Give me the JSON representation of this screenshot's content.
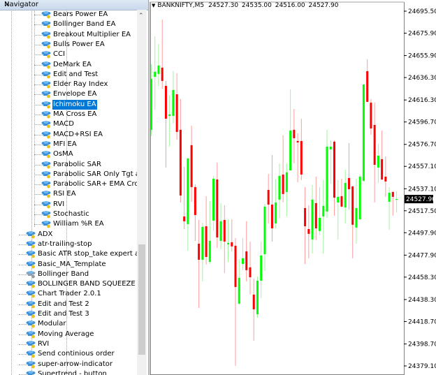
{
  "navigator": {
    "title": "Navigator",
    "close_label": "×",
    "items": [
      {
        "label": "Bears Power EA",
        "level": 2
      },
      {
        "label": "Bollinger Band EA",
        "level": 2
      },
      {
        "label": "Breakout Multiplier EA",
        "level": 2
      },
      {
        "label": "Bulls Power EA",
        "level": 2
      },
      {
        "label": "CCI",
        "level": 2
      },
      {
        "label": "DeMark EA",
        "level": 2
      },
      {
        "label": "Edit and Test",
        "level": 2
      },
      {
        "label": "Elder Ray Index",
        "level": 2
      },
      {
        "label": "Envelope EA",
        "level": 2
      },
      {
        "label": "Ichimoku EA",
        "level": 2,
        "selected": true
      },
      {
        "label": "MA Cross EA",
        "level": 2
      },
      {
        "label": "MACD",
        "level": 2
      },
      {
        "label": "MACD+RSI EA",
        "level": 2
      },
      {
        "label": "MFI EA",
        "level": 2
      },
      {
        "label": "OsMA",
        "level": 2
      },
      {
        "label": "Parabolic SAR",
        "level": 2
      },
      {
        "label": "Parabolic SAR Only Tgt and",
        "level": 2
      },
      {
        "label": "Parabolic SAR+ EMA Cross",
        "level": 2
      },
      {
        "label": "RSI EA",
        "level": 2
      },
      {
        "label": "RVI",
        "level": 2
      },
      {
        "label": "Stochastic",
        "level": 2
      },
      {
        "label": "William %R EA",
        "level": 2
      },
      {
        "label": "ADX",
        "level": 1
      },
      {
        "label": "atr-trailing-stop",
        "level": 1
      },
      {
        "label": "Basic ATR stop_take expert advi",
        "level": 1
      },
      {
        "label": "Basic_MA_Template",
        "level": 1
      },
      {
        "label": "Bollinger Band",
        "level": 1,
        "grey": true
      },
      {
        "label": "BOLLINGER BAND SQUEEZE",
        "level": 1
      },
      {
        "label": "Chart Trader 2.0.1",
        "level": 1
      },
      {
        "label": "Edit and Test 2",
        "level": 1
      },
      {
        "label": "Edit and Test 3",
        "level": 1
      },
      {
        "label": "Modular",
        "level": 1
      },
      {
        "label": "Moving Average",
        "level": 1
      },
      {
        "label": "RVI",
        "level": 1
      },
      {
        "label": "Send continious order",
        "level": 1
      },
      {
        "label": "super-arrow-indicator",
        "level": 1
      },
      {
        "label": "Supertrend - button",
        "level": 1
      }
    ]
  },
  "chart": {
    "symbol": "BANKNIFTY,M5",
    "ohlc_readout": "24527.30 24535.00 24516.00 24527.90",
    "current_price": "24527.90",
    "colors": {
      "bull": "#00ff00",
      "bear": "#ff0000",
      "bull_wick": "#9ef59e",
      "bear_wick": "#ff9c9c",
      "current_bg": "#000000"
    }
  },
  "chart_data": {
    "type": "candlestick",
    "ylim": [
      24379.1,
      24695.5
    ],
    "y_ticks": [
      "24695.50",
      "24675.90",
      "24655.90",
      "24636.30",
      "24616.30",
      "24596.70",
      "24576.70",
      "24557.10",
      "24537.10",
      "24517.50",
      "24497.90",
      "24477.90",
      "24458.30",
      "24438.30",
      "24418.70",
      "24398.70",
      "24379.10"
    ],
    "candles": [
      [
        24589.7,
        24648.2,
        24584.1,
        24635.1
      ],
      [
        24637.0,
        24673.1,
        24607.7,
        24641.4
      ],
      [
        24639.5,
        24666.3,
        24628.9,
        24647.0
      ],
      [
        24645.1,
        24688.1,
        24626.4,
        24633.3
      ],
      [
        24628.9,
        24633.3,
        24556.0,
        24599.6
      ],
      [
        24602.1,
        24620.2,
        24574.7,
        24603.4
      ],
      [
        24602.1,
        24642.0,
        24595.3,
        24625.2
      ],
      [
        24621.4,
        24640.1,
        24580.9,
        24587.8
      ],
      [
        24589.7,
        24617.1,
        24524.9,
        24531.1
      ],
      [
        24512.4,
        24556.7,
        24501.2,
        24508.1
      ],
      [
        24505.6,
        24564.7,
        24481.9,
        24564.1
      ],
      [
        24576.0,
        24593.4,
        24525.5,
        24538.6
      ],
      [
        24538.6,
        24541.1,
        24490.6,
        24513.7
      ],
      [
        24488.1,
        24509.3,
        24430.8,
        24473.8
      ],
      [
        24473.8,
        24506.8,
        24454.5,
        24503.1
      ],
      [
        24503.7,
        24530.5,
        24469.5,
        24476.3
      ],
      [
        24471.9,
        24526.1,
        24470.1,
        24490.6
      ],
      [
        24508.7,
        24548.6,
        24500.0,
        24546.1
      ],
      [
        24545.4,
        24560.4,
        24484.4,
        24493.7
      ],
      [
        24490.6,
        24524.3,
        24483.2,
        24508.1
      ],
      [
        24509.3,
        24522.4,
        24462.0,
        24490.0
      ],
      [
        24487.5,
        24509.9,
        24471.9,
        24488.8
      ],
      [
        24489.4,
        24509.9,
        24481.3,
        24485.7
      ],
      [
        24486.3,
        24493.1,
        24379.2,
        24449.5
      ],
      [
        24434.6,
        24474.4,
        24434.0,
        24457.6
      ],
      [
        24470.1,
        24493.1,
        24464.5,
        24475.1
      ],
      [
        24481.3,
        24508.1,
        24454.5,
        24464.5
      ],
      [
        24467.0,
        24490.0,
        24442.7,
        24458.2
      ],
      [
        24442.7,
        24457.0,
        24401.6,
        24429.6
      ],
      [
        24425.2,
        24458.9,
        24422.1,
        24455.1
      ],
      [
        24455.1,
        24490.0,
        24439.6,
        24477.6
      ],
      [
        24478.8,
        24523.6,
        24463.9,
        24521.2
      ],
      [
        24536.1,
        24550.4,
        24506.2,
        24523.0
      ],
      [
        24523.0,
        24567.2,
        24490.0,
        24501.8
      ],
      [
        24506.2,
        24545.4,
        24501.8,
        24524.9
      ],
      [
        24527.4,
        24559.8,
        24510.6,
        24548.6
      ],
      [
        24549.8,
        24584.7,
        24524.9,
        24532.4
      ],
      [
        24534.2,
        24559.8,
        24512.4,
        24551.7
      ],
      [
        24553.5,
        24625.8,
        24553.5,
        24589.0
      ],
      [
        24589.7,
        24608.3,
        24559.8,
        24582.2
      ],
      [
        24579.7,
        24586.5,
        24542.9,
        24578.4
      ],
      [
        24579.7,
        24599.6,
        24544.8,
        24549.8
      ],
      [
        24519.9,
        24538.6,
        24470.1,
        24503.7
      ],
      [
        24501.2,
        24522.4,
        24475.1,
        24496.9
      ],
      [
        24491.9,
        24540.5,
        24479.4,
        24527.4
      ],
      [
        24524.3,
        24547.9,
        24491.3,
        24501.8
      ],
      [
        24499.4,
        24538.6,
        24495.6,
        24511.2
      ],
      [
        24512.4,
        24544.8,
        24479.4,
        24521.8
      ],
      [
        24516.8,
        24589.7,
        24511.2,
        24574.7
      ],
      [
        24572.2,
        24580.3,
        24541.7,
        24574.7
      ],
      [
        24579.1,
        24580.3,
        24513.1,
        24529.2
      ],
      [
        24524.9,
        24544.8,
        24491.9,
        24529.9
      ],
      [
        24530.5,
        24546.1,
        24520.5,
        24521.2
      ],
      [
        24520.5,
        24554.2,
        24506.2,
        24542.3
      ],
      [
        24546.7,
        24577.8,
        24518.7,
        24536.7
      ],
      [
        24539.2,
        24539.8,
        24475.1,
        24505.0
      ],
      [
        24502.5,
        24546.1,
        24488.1,
        24519.9
      ],
      [
        24509.9,
        24549.8,
        24509.3,
        24547.9
      ],
      [
        24544.2,
        24630.1,
        24543.6,
        24630.1
      ],
      [
        24642.0,
        24652.6,
        24614.6,
        24614.6
      ],
      [
        24613.9,
        24617.1,
        24585.3,
        24590.9
      ],
      [
        24594.0,
        24613.9,
        24524.9,
        24558.5
      ],
      [
        24556.0,
        24577.2,
        24542.3,
        24566.6
      ],
      [
        24563.5,
        24589.0,
        24544.8,
        24545.4
      ],
      [
        24547.9,
        24566.0,
        24529.9,
        24543.6
      ],
      [
        24525.5,
        24538.6,
        24500.6,
        24533.6
      ],
      [
        24534.2,
        24534.9,
        24513.1,
        24529.9
      ],
      [
        24527.3,
        24535.0,
        24516.0,
        24527.9
      ]
    ]
  }
}
